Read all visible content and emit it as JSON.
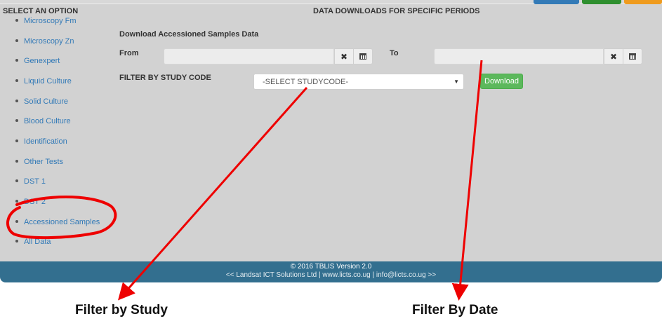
{
  "top_buttons": [
    {
      "color": "#337ab7"
    },
    {
      "color": "#2f8f2f"
    },
    {
      "color": "#ef9b1e"
    }
  ],
  "sidebar": {
    "heading": "SELECT AN OPTION",
    "items": [
      {
        "label": "Microscopy Fm"
      },
      {
        "label": "Microscopy Zn"
      },
      {
        "label": "Genexpert"
      },
      {
        "label": "Liquid Culture"
      },
      {
        "label": "Solid Culture"
      },
      {
        "label": "Blood Culture"
      },
      {
        "label": "Identification"
      },
      {
        "label": "Other Tests"
      },
      {
        "label": "DST 1"
      },
      {
        "label": "DST 2"
      },
      {
        "label": "Accessioned Samples"
      },
      {
        "label": "All Data"
      }
    ]
  },
  "main": {
    "title": "DATA DOWNLOADS FOR SPECIFIC PERIODS",
    "section_heading": "Download Accessioned Samples Data",
    "from_label": "From",
    "to_label": "To",
    "from_value": "",
    "to_value": "",
    "study_label": "FILTER BY STUDY CODE",
    "study_select_value": "-SELECT STUDYCODE-",
    "download_label": "Download",
    "clear_icon": "times-icon",
    "calendar_icon": "calendar-icon"
  },
  "footer": {
    "line1": "© 2016 TBLIS Version 2.0",
    "line2": "<< Landsat ICT Solutions Ltd | www.licts.co.ug | info@licts.co.ug >>"
  },
  "annotations": {
    "study_caption": "Filter by Study",
    "date_caption": "Filter By Date",
    "color": "#ee0000"
  }
}
